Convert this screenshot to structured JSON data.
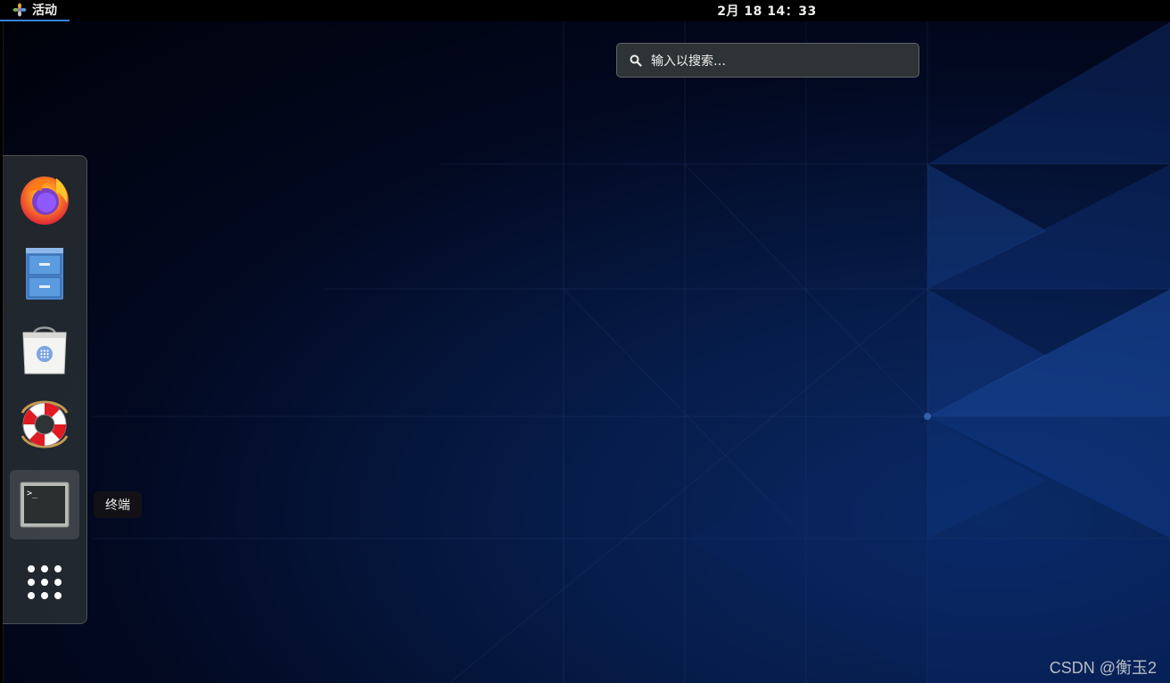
{
  "topbar": {
    "activities_label": "活动",
    "clock": "2月 18  14：33"
  },
  "search": {
    "placeholder": "输入以搜索…",
    "icon": "search-icon"
  },
  "dash": {
    "items": [
      {
        "name": "Firefox",
        "icon": "firefox-icon"
      },
      {
        "name": "Files",
        "icon": "file-cabinet-icon"
      },
      {
        "name": "Software",
        "icon": "software-bag-icon"
      },
      {
        "name": "Help",
        "icon": "lifebuoy-icon"
      },
      {
        "name": "终端",
        "icon": "terminal-icon",
        "active": true
      },
      {
        "name": "Show Applications",
        "icon": "app-grid-icon"
      }
    ],
    "tooltip": "终端"
  },
  "watermark": "CSDN @衡玉2",
  "colors": {
    "topbar_bg": "#000000",
    "accent": "#3584e4",
    "panel": "#2e3436",
    "desktop_blue": "#0a2a66"
  }
}
